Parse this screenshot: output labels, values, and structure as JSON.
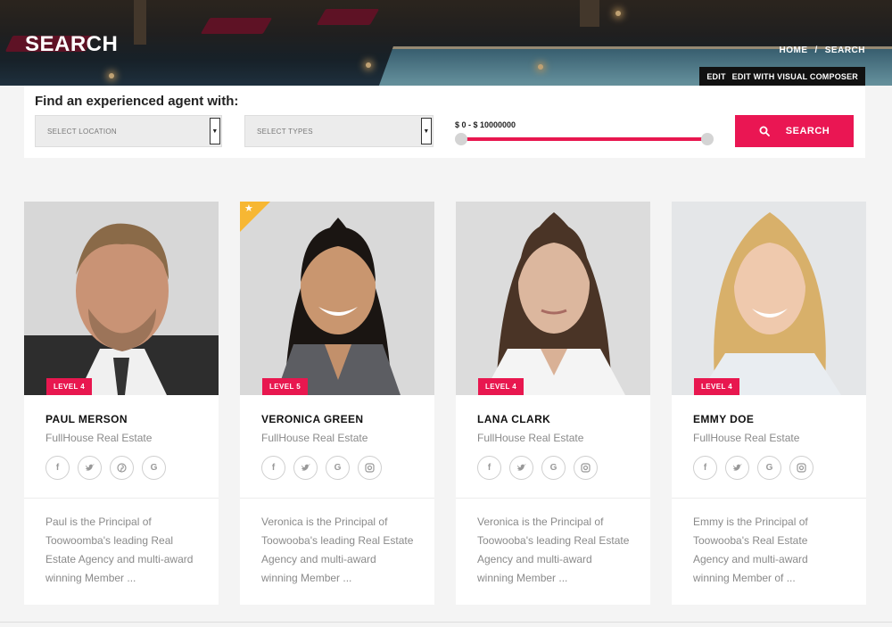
{
  "header": {
    "title": "SEARCH",
    "breadcrumb": [
      {
        "label": "HOME"
      },
      {
        "label": "/"
      },
      {
        "label": "SEARCH"
      }
    ],
    "edit_bar": {
      "edit_label": "EDIT",
      "visual_composer_label": "EDIT WITH VISUAL COMPOSER"
    }
  },
  "search": {
    "heading": "Find an experienced agent with:",
    "location_placeholder": "SELECT LOCATION",
    "types_placeholder": "SELECT TYPES",
    "price_range_label": "$ 0 - $ 10000000",
    "button_label": "SEARCH",
    "accent_color": "#ea1653"
  },
  "agents": [
    {
      "name": "PAUL MERSON",
      "agency": "FullHouse Real Estate",
      "level": "LEVEL 4",
      "featured": false,
      "socials": [
        "facebook-icon",
        "twitter-icon",
        "pinterest-icon",
        "google-icon"
      ],
      "bio_lines": [
        "Paul is the Principal of",
        "Toowoomba's leading Real",
        "Estate Agency and multi-award",
        "winning Member ..."
      ]
    },
    {
      "name": "VERONICA GREEN",
      "agency": "FullHouse Real Estate",
      "level": "LEVEL 5",
      "featured": true,
      "socials": [
        "facebook-icon",
        "twitter-icon",
        "google-icon",
        "instagram-icon"
      ],
      "bio_lines": [
        "Veronica is the Principal of",
        "Toowooba's leading Real Estate",
        "Agency and multi-award",
        "winning Member ..."
      ]
    },
    {
      "name": "LANA CLARK",
      "agency": "FullHouse Real Estate",
      "level": "LEVEL 4",
      "featured": false,
      "socials": [
        "facebook-icon",
        "twitter-icon",
        "google-icon",
        "instagram-icon"
      ],
      "bio_lines": [
        "Veronica is the Principal of",
        "Toowooba's leading Real Estate",
        "Agency and multi-award",
        "winning Member ..."
      ]
    },
    {
      "name": "EMMY DOE",
      "agency": "FullHouse Real Estate",
      "level": "LEVEL 4",
      "featured": false,
      "socials": [
        "facebook-icon",
        "twitter-icon",
        "google-icon",
        "instagram-icon"
      ],
      "bio_lines": [
        "Emmy is the Principal of",
        "Toowooba's Real Estate",
        "Agency and multi-award",
        "winning Member of ..."
      ]
    }
  ]
}
